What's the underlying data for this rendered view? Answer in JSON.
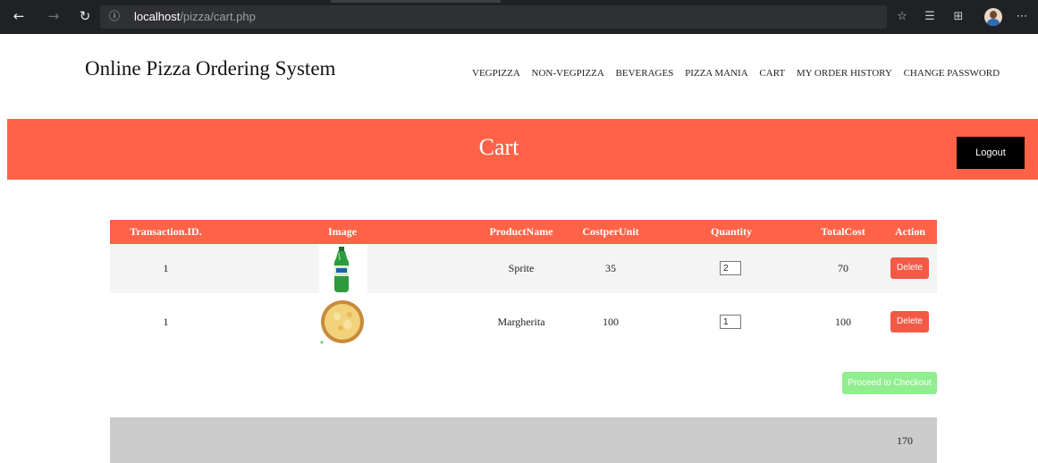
{
  "browser": {
    "url_host": "localhost",
    "url_path": "/pizza/cart.php"
  },
  "site": {
    "title": "Online Pizza Ordering System",
    "nav": [
      "VEGPIZZA",
      "NON-VEGPIZZA",
      "BEVERAGES",
      "PIZZA MANIA",
      "CART",
      "MY ORDER HISTORY",
      "CHANGE PASSWORD"
    ]
  },
  "banner": {
    "title": "Cart",
    "logout_label": "Logout",
    "color": "#ff6347"
  },
  "table": {
    "headers": [
      "Transaction.ID.",
      "Image",
      "ProductName",
      "CostperUnit",
      "Quantity",
      "TotalCost",
      "Action"
    ],
    "rows": [
      {
        "transaction_id": "1",
        "image": "sprite-bottle",
        "product": "Sprite",
        "cost": "35",
        "quantity": "2",
        "total": "70",
        "action": "Delete"
      },
      {
        "transaction_id": "1",
        "image": "margherita-pizza",
        "product": "Margherita",
        "cost": "100",
        "quantity": "1",
        "total": "100",
        "action": "Delete"
      }
    ]
  },
  "checkout_label": "Proceed to Checkout",
  "grand_total": "170"
}
